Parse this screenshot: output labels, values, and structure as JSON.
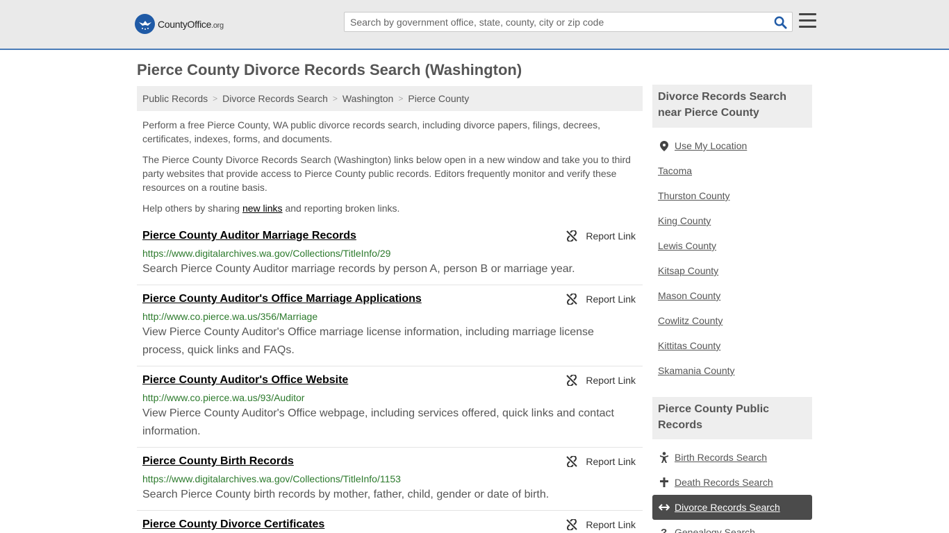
{
  "header": {
    "logo_main": "CountyOffice",
    "logo_suffix": ".org",
    "search_placeholder": "Search by government office, state, county, city or zip code"
  },
  "page_title": "Pierce County Divorce Records Search (Washington)",
  "breadcrumb": [
    "Public Records",
    "Divorce Records Search",
    "Washington",
    "Pierce County"
  ],
  "intro": {
    "p1": "Perform a free Pierce County, WA public divorce records search, including divorce papers, filings, decrees, certificates, indexes, forms, and documents.",
    "p2": "The Pierce County Divorce Records Search (Washington) links below open in a new window and take you to third party websites that provide access to Pierce County public records. Editors frequently monitor and verify these resources on a routine basis.",
    "p3_before": "Help others by sharing ",
    "p3_link": "new links",
    "p3_after": " and reporting broken links."
  },
  "report_label": "Report Link",
  "entries": [
    {
      "title": "Pierce County Auditor Marriage Records",
      "url": "https://www.digitalarchives.wa.gov/Collections/TitleInfo/29",
      "desc": "Search Pierce County Auditor marriage records by person A, person B or marriage year."
    },
    {
      "title": "Pierce County Auditor's Office Marriage Applications",
      "url": "http://www.co.pierce.wa.us/356/Marriage",
      "desc": "View Pierce County Auditor's Office marriage license information, including marriage license process, quick links and FAQs."
    },
    {
      "title": "Pierce County Auditor's Office Website",
      "url": "http://www.co.pierce.wa.us/93/Auditor",
      "desc": "View Pierce County Auditor's Office webpage, including services offered, quick links and contact information."
    },
    {
      "title": "Pierce County Birth Records",
      "url": "https://www.digitalarchives.wa.gov/Collections/TitleInfo/1153",
      "desc": "Search Pierce County birth records by mother, father, child, gender or date of birth."
    },
    {
      "title": "Pierce County Divorce Certificates",
      "url": "",
      "desc": ""
    }
  ],
  "sidebar": {
    "near_title": "Divorce Records Search near Pierce County",
    "use_location": "Use My Location",
    "near_links": [
      "Tacoma",
      "Thurston County",
      "King County",
      "Lewis County",
      "Kitsap County",
      "Mason County",
      "Cowlitz County",
      "Kittitas County",
      "Skamania County"
    ],
    "records_title": "Pierce County Public Records",
    "records_links": [
      {
        "label": "Birth Records Search",
        "icon": "baby-icon"
      },
      {
        "label": "Death Records Search",
        "icon": "cross-icon"
      },
      {
        "label": "Divorce Records Search",
        "icon": "split-arrows-icon",
        "active": true
      },
      {
        "label": "Genealogy Search",
        "icon": "question-icon"
      }
    ]
  },
  "colors": {
    "header_bg": "#eaeaea",
    "header_border": "#4a7bb7",
    "url_green": "#2c7a2c",
    "active_bg": "#4b4b4b"
  }
}
